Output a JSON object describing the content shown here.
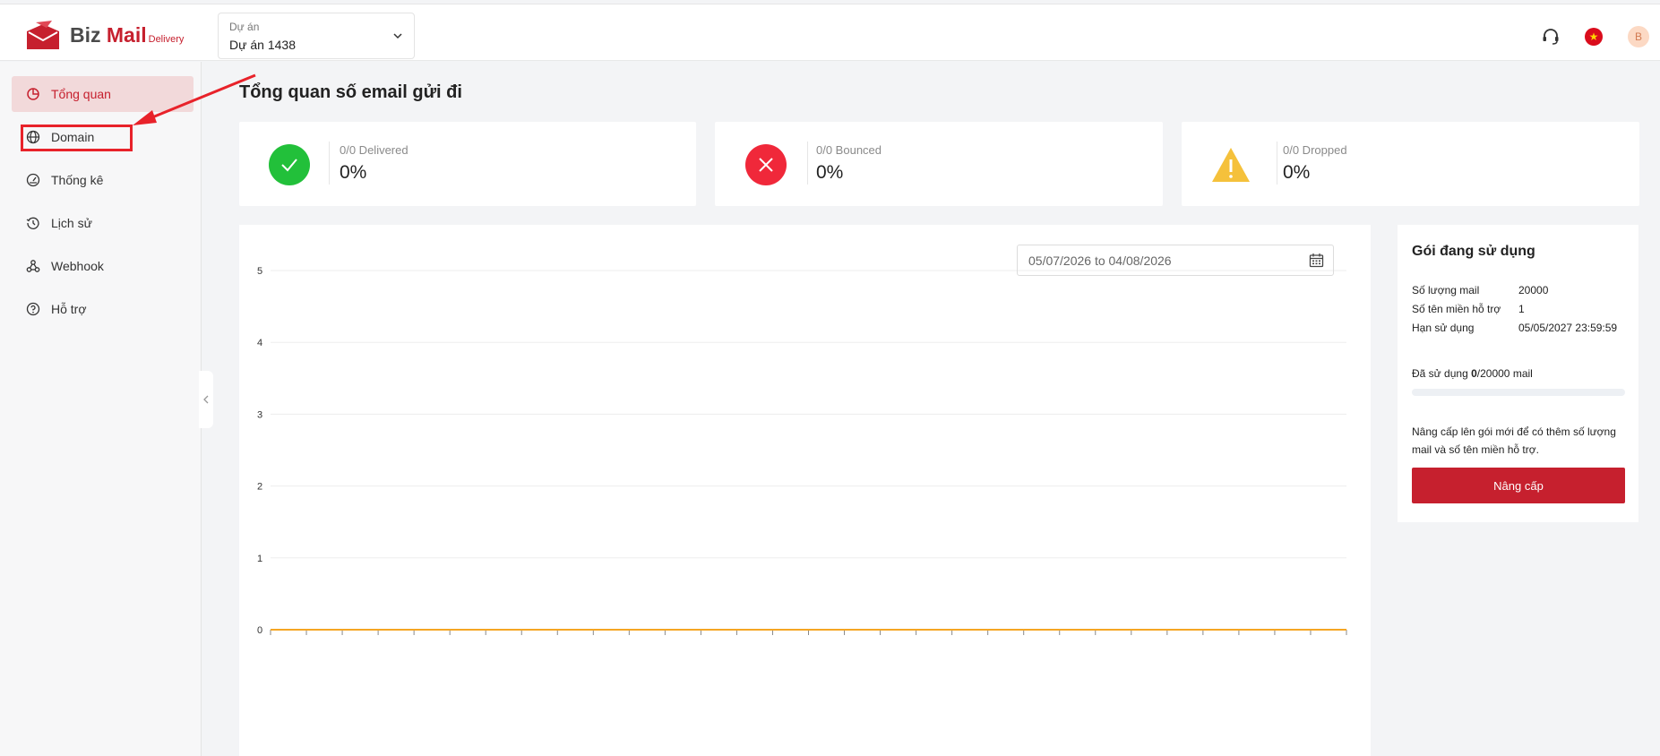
{
  "app": {
    "logo_biz": "Biz",
    "logo_mail": "Mail",
    "logo_delivery": "Delivery"
  },
  "project": {
    "label": "Dự án",
    "value": "Dự án 1438"
  },
  "header": {
    "avatar_initial": "B"
  },
  "sidebar": {
    "items": [
      {
        "label": "Tổng quan",
        "icon": "pie-chart-icon",
        "active": true
      },
      {
        "label": "Domain",
        "icon": "globe-icon",
        "active": false
      },
      {
        "label": "Thống kê",
        "icon": "dashboard-icon",
        "active": false
      },
      {
        "label": "Lịch sử",
        "icon": "history-icon",
        "active": false
      },
      {
        "label": "Webhook",
        "icon": "webhook-icon",
        "active": false
      },
      {
        "label": "Hỗ trợ",
        "icon": "help-circle-icon",
        "active": false
      }
    ]
  },
  "main": {
    "title": "Tổng quan số email gửi đi",
    "stats": [
      {
        "label": "0/0 Delivered",
        "value": "0%",
        "color": "#22c03a",
        "icon": "check-icon"
      },
      {
        "label": "0/0 Bounced",
        "value": "0%",
        "color": "#f0283a",
        "icon": "close-icon"
      },
      {
        "label": "0/0 Dropped",
        "value": "0%",
        "color": "#f5c13b",
        "icon": "warning-icon"
      }
    ],
    "date_range": "05/07/2026 to 04/08/2026"
  },
  "chart_data": {
    "type": "line",
    "ylim": [
      0,
      5
    ],
    "y_ticks": [
      "0",
      "1",
      "2",
      "3",
      "4",
      "5"
    ],
    "x_count": 31,
    "series": [
      {
        "values": [
          0,
          0,
          0,
          0,
          0,
          0,
          0,
          0,
          0,
          0,
          0,
          0,
          0,
          0,
          0,
          0,
          0,
          0,
          0,
          0,
          0,
          0,
          0,
          0,
          0,
          0,
          0,
          0,
          0,
          0,
          0
        ],
        "color": "#f5a623"
      }
    ]
  },
  "plan": {
    "title": "Gói đang sử dụng",
    "rows": [
      {
        "key": "Số lượng mail",
        "value": "20000"
      },
      {
        "key": "Số tên miền hỗ trợ",
        "value": "1"
      },
      {
        "key": "Hạn sử dụng",
        "value": "05/05/2027 23:59:59"
      }
    ],
    "used_prefix": "Đã sử dụng",
    "used_count": "0",
    "used_suffix": "/20000 mail",
    "used_fraction": 0,
    "upgrade_text": "Nâng cấp lên gói mới để có thêm số lượng mail và số tên miền hỗ trợ.",
    "upgrade_button": "Nâng cấp"
  },
  "colors": {
    "brand": "#c6202e",
    "annotation": "#e8222a"
  }
}
